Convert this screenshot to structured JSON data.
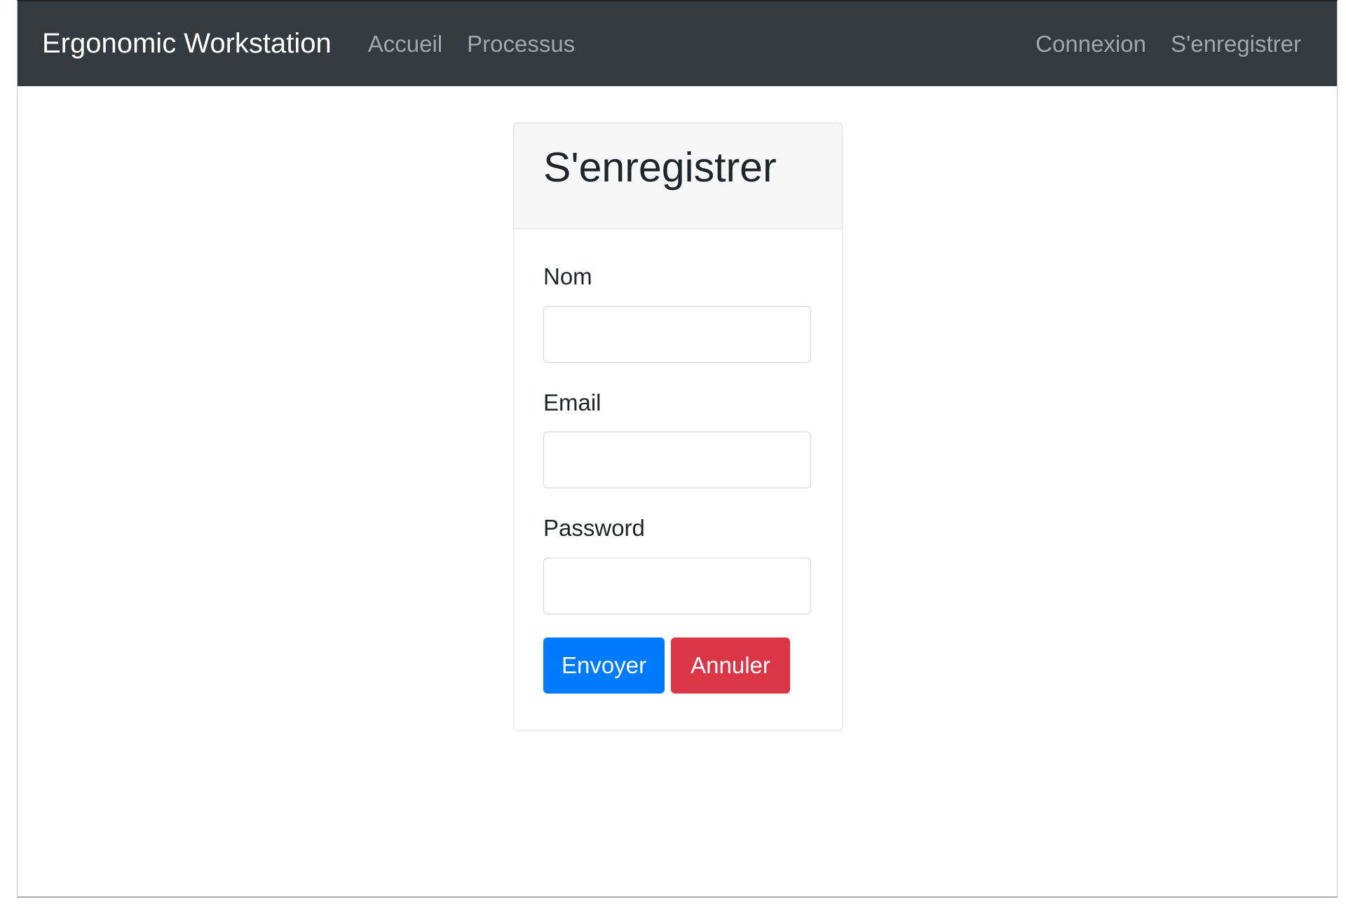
{
  "navbar": {
    "brand": "Ergonomic Workstation",
    "left_links": [
      "Accueil",
      "Processus"
    ],
    "right_links": [
      "Connexion",
      "S'enregistrer"
    ]
  },
  "form": {
    "title": "S'enregistrer",
    "fields": [
      {
        "label": "Nom",
        "value": ""
      },
      {
        "label": "Email",
        "value": ""
      },
      {
        "label": "Password",
        "value": ""
      }
    ],
    "submit_label": "Envoyer",
    "cancel_label": "Annuler"
  },
  "colors": {
    "navbar_bg": "#343a40",
    "primary": "#007bff",
    "danger": "#dc3545"
  }
}
